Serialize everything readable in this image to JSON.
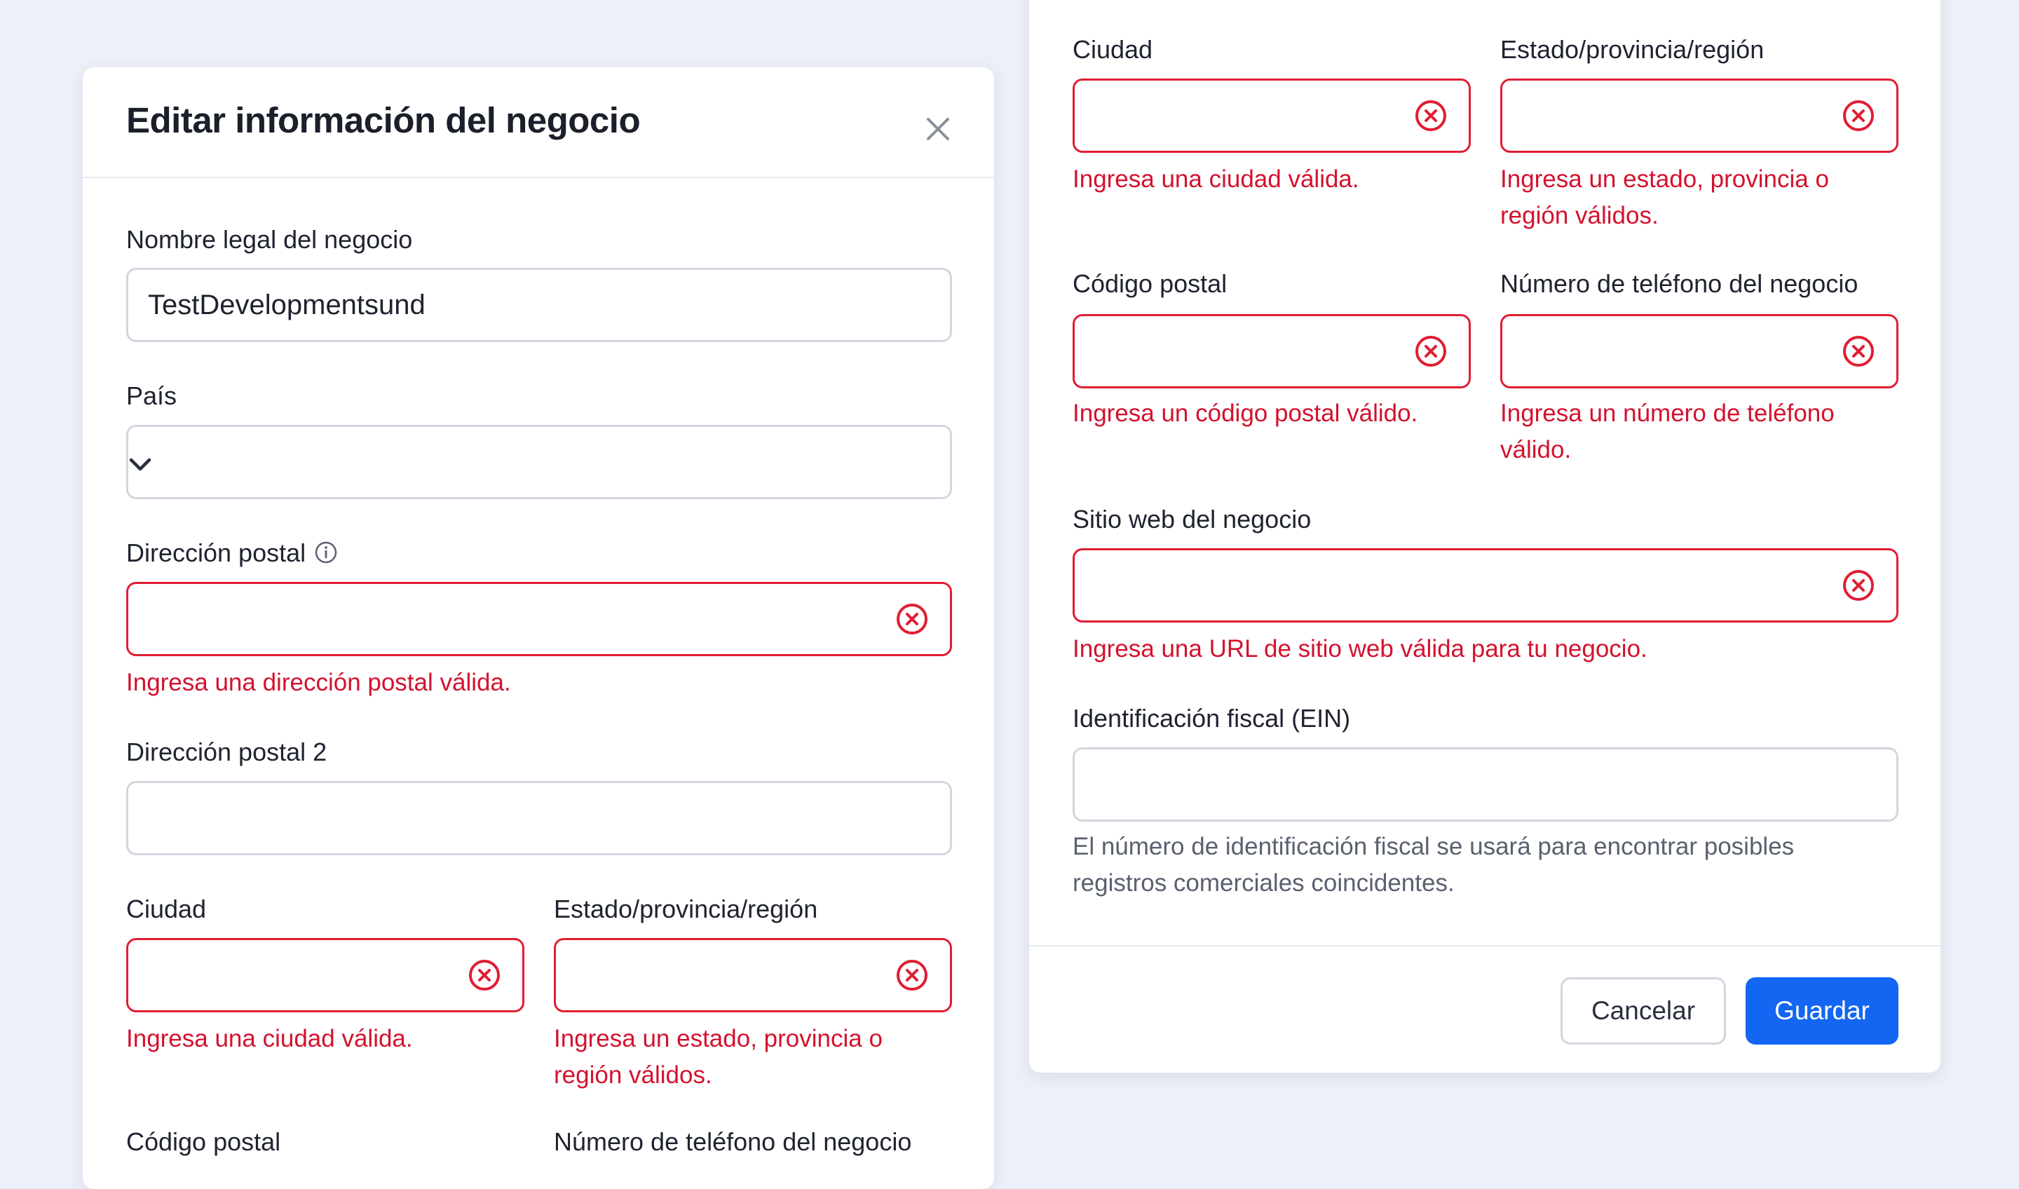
{
  "dialog": {
    "title": "Editar información del negocio"
  },
  "form": {
    "legal_name_label": "Nombre legal del negocio",
    "legal_name_value": "TestDevelopmentsund",
    "country_label": "País",
    "address_label": "Dirección postal",
    "address_error": "Ingresa una dirección postal válida.",
    "address2_label": "Dirección postal 2",
    "city_label": "Ciudad",
    "city_error": "Ingresa una ciudad válida.",
    "state_label": "Estado/provincia/región",
    "state_error_line1": "Ingresa un estado, provincia o",
    "state_error_line2": "región válidos.",
    "zip_label": "Código postal",
    "zip_error": "Ingresa un código postal válido.",
    "phone_label": "Número de teléfono del negocio",
    "phone_error_line1": "Ingresa un número de teléfono",
    "phone_error_line2": "válido.",
    "website_label": "Sitio web del negocio",
    "website_error": "Ingresa una URL de sitio web válida para tu negocio.",
    "ein_label": "Identificación fiscal (EIN)",
    "ein_help_line1": "El número de identificación fiscal se usará para encontrar posibles",
    "ein_help_line2": "registros comerciales coincidentes."
  },
  "footer": {
    "cancel_label": "Cancelar",
    "save_label": "Guardar"
  },
  "colors": {
    "error": "#e11d33",
    "primary": "#1366f2",
    "background": "#edf0f8"
  },
  "icons": {
    "close": "close-icon",
    "error": "error-circle-icon",
    "info": "info-icon",
    "dropdown": "chevron-down-icon"
  }
}
